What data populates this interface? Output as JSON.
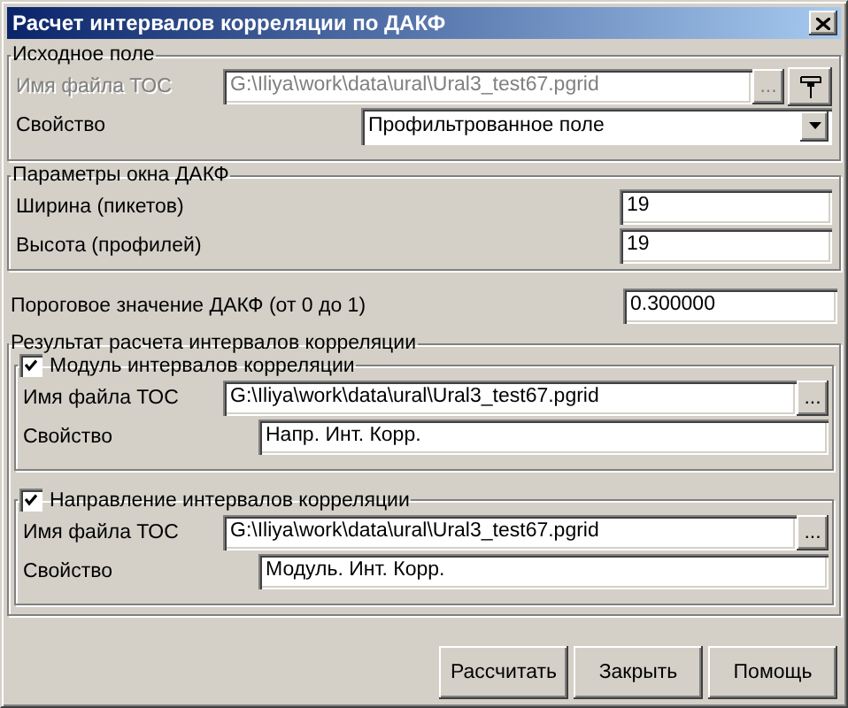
{
  "window": {
    "title": "Расчет интервалов корреляции по ДАКФ"
  },
  "source": {
    "title": "Исходное поле",
    "file_label": "Имя файла ТОС",
    "file_value": "G:\\Iliya\\work\\data\\ural\\Ural3_test67.pgrid",
    "disabled": true,
    "browse_button": "...",
    "property_label": "Свойство",
    "property_value": "Профильтрованное поле"
  },
  "window_params": {
    "title": "Параметры окна ДАКФ",
    "rows": [
      {
        "label": "Ширина (пикетов)",
        "value": "19"
      },
      {
        "label": "Высота (профилей)",
        "value": "19"
      }
    ]
  },
  "threshold": {
    "label": "Пороговое значение ДАКФ (от 0 до 1)",
    "value": "0.300000"
  },
  "result": {
    "title": "Результат расчета интервалов корреляции",
    "groups": [
      {
        "title": "Модуль интервалов корреляции",
        "checked": true,
        "file_label": "Имя файла ТОС",
        "file_value": "G:\\Iliya\\work\\data\\ural\\Ural3_test67.pgrid",
        "browse_button": "...",
        "property_label": "Свойство",
        "property_value": "Напр. Инт. Корр."
      },
      {
        "title": "Направление интервалов корреляции",
        "checked": true,
        "file_label": "Имя файла ТОС",
        "file_value": "G:\\Iliya\\work\\data\\ural\\Ural3_test67.pgrid",
        "browse_button": "...",
        "property_label": "Свойство",
        "property_value": "Модуль. Инт. Корр."
      }
    ]
  },
  "buttons": [
    "Рассчитать",
    "Закрыть",
    "Помощь"
  ]
}
